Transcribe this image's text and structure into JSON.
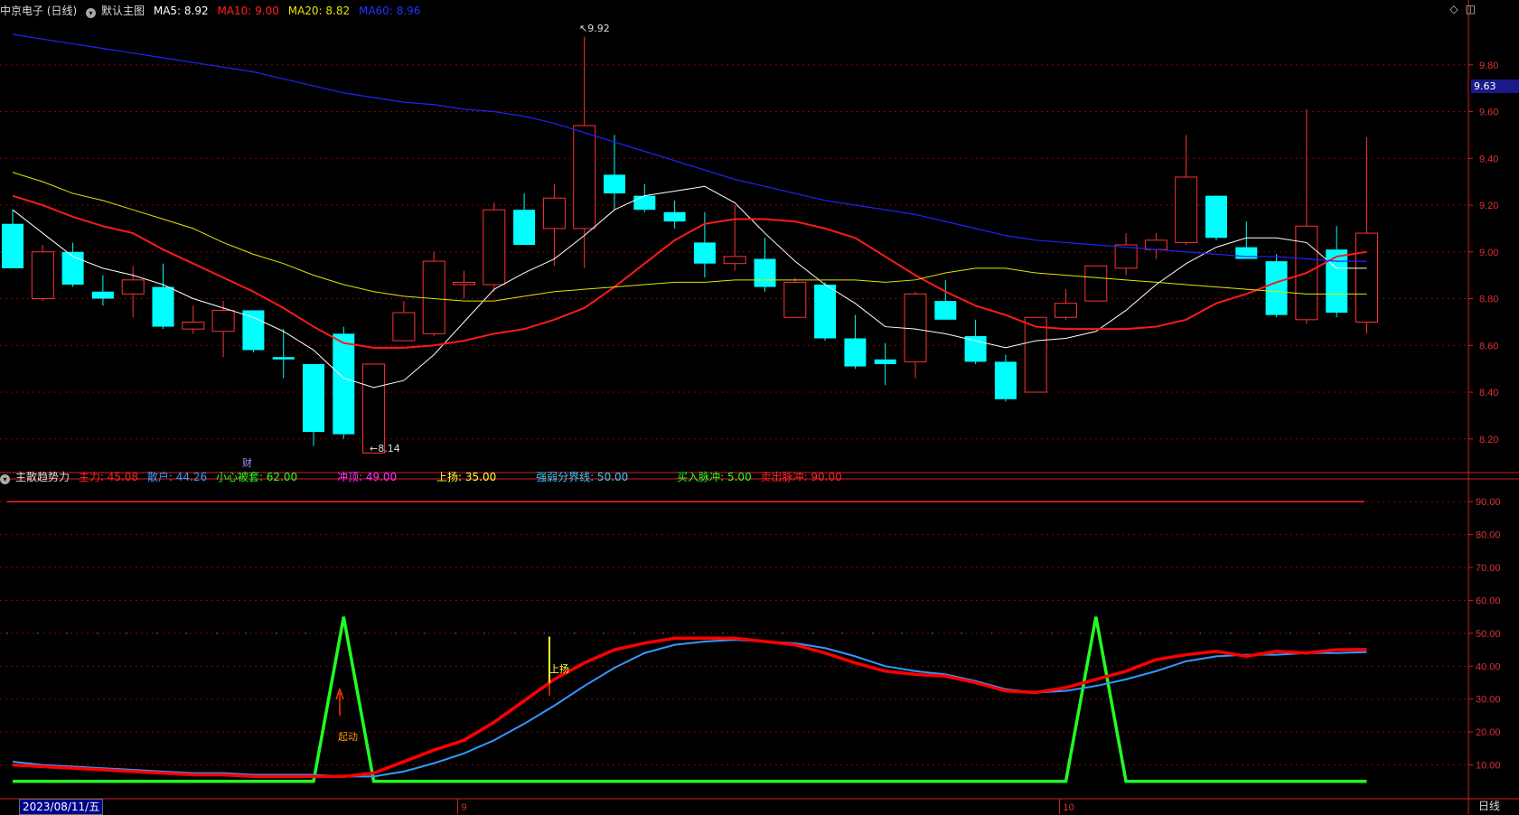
{
  "header_main": {
    "title": "中京电子 (日线)",
    "chart_name": "默认主图",
    "ma5": "MA5: 8.92",
    "ma10": "MA10: 9.00",
    "ma20": "MA20: 8.82",
    "ma60": "MA60: 8.96"
  },
  "header_sub": {
    "name": "主散趋势力",
    "zhuli": "主力: 45.08",
    "sanhu": "散户: 44.26",
    "xiaoxin": "小心被套: 62.00",
    "chongding": "冲顶: 49.00",
    "shangyang": "上扬: 35.00",
    "qiangruo": "强弱分界线: 50.00",
    "mairu": "买入脉冲: 5.00",
    "maichu": "卖出脉冲: 90.00"
  },
  "current_price": "9.63",
  "high_marker": "9.92",
  "low_marker": "8.14",
  "cai_marker": "财",
  "signal_qidong": "起动",
  "signal_shangyang": "上扬",
  "date_cursor": "2023/08/11/五",
  "period_label": "日线",
  "x_labels": [
    {
      "text": "9",
      "index": 15
    },
    {
      "text": "10",
      "index": 35
    }
  ],
  "colors": {
    "up": "#ff3232",
    "down": "#00ffff",
    "ma5": "#ffffff",
    "ma10": "#ff1a1a",
    "ma20": "#e6e600",
    "ma60": "#2222ff",
    "zhuli": "#ff0000",
    "sanhu": "#3399ff",
    "pulse": "#22ff22",
    "grid": "#8b0000",
    "axis": "#cc2222"
  },
  "chart_data": [
    {
      "type": "candlestick",
      "ylim": [
        8.06,
        10.0
      ],
      "yticks": [
        8.2,
        8.4,
        8.6,
        8.8,
        9.0,
        9.2,
        9.4,
        9.6,
        9.8
      ],
      "ohlc": [
        [
          9.12,
          9.18,
          8.93,
          8.93
        ],
        [
          8.8,
          9.03,
          8.79,
          9.0
        ],
        [
          9.0,
          9.04,
          8.85,
          8.86
        ],
        [
          8.83,
          8.9,
          8.77,
          8.8
        ],
        [
          8.82,
          8.94,
          8.72,
          8.88
        ],
        [
          8.85,
          8.95,
          8.67,
          8.68
        ],
        [
          8.67,
          8.77,
          8.65,
          8.7
        ],
        [
          8.66,
          8.79,
          8.55,
          8.75
        ],
        [
          8.75,
          8.75,
          8.57,
          8.58
        ],
        [
          8.55,
          8.67,
          8.46,
          8.54
        ],
        [
          8.52,
          8.52,
          8.17,
          8.23
        ],
        [
          8.65,
          8.68,
          8.2,
          8.22
        ],
        [
          8.14,
          8.52,
          8.14,
          8.52
        ],
        [
          8.62,
          8.79,
          8.62,
          8.74
        ],
        [
          8.65,
          9.0,
          8.64,
          8.96
        ],
        [
          8.86,
          8.92,
          8.8,
          8.87
        ],
        [
          8.86,
          9.21,
          8.83,
          9.18
        ],
        [
          9.18,
          9.25,
          9.03,
          9.03
        ],
        [
          9.1,
          9.29,
          8.94,
          9.23
        ],
        [
          9.1,
          9.92,
          8.93,
          9.54
        ],
        [
          9.33,
          9.5,
          9.18,
          9.25
        ],
        [
          9.24,
          9.29,
          9.17,
          9.18
        ],
        [
          9.17,
          9.22,
          9.1,
          9.13
        ],
        [
          9.04,
          9.17,
          8.89,
          8.95
        ],
        [
          8.95,
          9.2,
          8.92,
          8.98
        ],
        [
          8.97,
          9.06,
          8.83,
          8.85
        ],
        [
          8.72,
          8.89,
          8.72,
          8.87
        ],
        [
          8.86,
          8.87,
          8.62,
          8.63
        ],
        [
          8.63,
          8.73,
          8.5,
          8.51
        ],
        [
          8.54,
          8.61,
          8.43,
          8.52
        ],
        [
          8.53,
          8.83,
          8.46,
          8.82
        ],
        [
          8.79,
          8.88,
          8.73,
          8.71
        ],
        [
          8.64,
          8.71,
          8.52,
          8.53
        ],
        [
          8.53,
          8.56,
          8.36,
          8.37
        ],
        [
          8.4,
          8.72,
          8.4,
          8.72
        ],
        [
          8.72,
          8.84,
          8.71,
          8.78
        ],
        [
          8.79,
          8.94,
          8.79,
          8.94
        ],
        [
          8.93,
          9.08,
          8.9,
          9.03
        ],
        [
          9.01,
          9.08,
          8.97,
          9.05
        ],
        [
          9.04,
          9.5,
          9.03,
          9.32
        ],
        [
          9.24,
          9.24,
          9.05,
          9.06
        ],
        [
          9.02,
          9.13,
          8.98,
          8.97
        ],
        [
          8.96,
          8.99,
          8.72,
          8.73
        ],
        [
          8.71,
          9.61,
          8.69,
          9.11
        ],
        [
          9.01,
          9.11,
          8.72,
          8.74
        ],
        [
          8.7,
          9.49,
          8.65,
          9.08
        ]
      ],
      "series": [
        {
          "name": "MA5",
          "values": [
            9.18,
            9.08,
            8.98,
            8.93,
            8.9,
            8.86,
            8.8,
            8.76,
            8.72,
            8.66,
            8.58,
            8.46,
            8.42,
            8.45,
            8.56,
            8.7,
            8.84,
            8.91,
            8.97,
            9.07,
            9.18,
            9.24,
            9.26,
            9.28,
            9.21,
            9.08,
            8.96,
            8.86,
            8.78,
            8.68,
            8.67,
            8.65,
            8.62,
            8.59,
            8.62,
            8.63,
            8.66,
            8.75,
            8.86,
            8.95,
            9.02,
            9.06,
            9.06,
            9.04,
            8.93,
            8.93
          ]
        },
        {
          "name": "MA10",
          "values": [
            9.24,
            9.2,
            9.15,
            9.11,
            9.08,
            9.01,
            8.95,
            8.89,
            8.83,
            8.76,
            8.68,
            8.61,
            8.59,
            8.59,
            8.6,
            8.62,
            8.65,
            8.67,
            8.71,
            8.76,
            8.85,
            8.95,
            9.05,
            9.12,
            9.14,
            9.14,
            9.13,
            9.1,
            9.06,
            8.98,
            8.9,
            8.83,
            8.77,
            8.73,
            8.68,
            8.67,
            8.67,
            8.67,
            8.68,
            8.71,
            8.78,
            8.82,
            8.87,
            8.91,
            8.98,
            9.0
          ]
        },
        {
          "name": "MA20",
          "values": [
            9.34,
            9.3,
            9.25,
            9.22,
            9.18,
            9.14,
            9.1,
            9.04,
            8.99,
            8.95,
            8.9,
            8.86,
            8.83,
            8.81,
            8.8,
            8.79,
            8.79,
            8.81,
            8.83,
            8.84,
            8.85,
            8.86,
            8.87,
            8.87,
            8.88,
            8.88,
            8.88,
            8.88,
            8.88,
            8.87,
            8.88,
            8.91,
            8.93,
            8.93,
            8.91,
            8.9,
            8.89,
            8.88,
            8.87,
            8.86,
            8.85,
            8.84,
            8.83,
            8.82,
            8.82,
            8.82
          ]
        },
        {
          "name": "MA60",
          "values": [
            9.93,
            9.91,
            9.89,
            9.87,
            9.85,
            9.83,
            9.81,
            9.79,
            9.77,
            9.74,
            9.71,
            9.68,
            9.66,
            9.64,
            9.63,
            9.61,
            9.6,
            9.58,
            9.55,
            9.51,
            9.47,
            9.43,
            9.39,
            9.35,
            9.31,
            9.28,
            9.25,
            9.22,
            9.2,
            9.18,
            9.16,
            9.13,
            9.1,
            9.07,
            9.05,
            9.04,
            9.03,
            9.02,
            9.01,
            9.0,
            8.99,
            8.98,
            8.98,
            8.97,
            8.96,
            8.96
          ]
        }
      ]
    },
    {
      "type": "line",
      "ylim": [
        0,
        95
      ],
      "yticks": [
        10,
        20,
        30,
        40,
        50,
        60,
        70,
        80,
        90
      ],
      "lines": [
        {
          "name": "卖出脉冲",
          "value": 90
        },
        {
          "name": "强弱分界线",
          "value": 50
        }
      ],
      "series": [
        {
          "name": "主力",
          "values": [
            10,
            9.5,
            9,
            8.5,
            8,
            7.5,
            7,
            7,
            6.5,
            6.5,
            6.5,
            6.5,
            7.5,
            11,
            14.5,
            17.5,
            23,
            29.5,
            36,
            41,
            45,
            47,
            48.5,
            48.5,
            48.5,
            47.5,
            46.5,
            44,
            41,
            38.5,
            37.5,
            37,
            35,
            32.5,
            32,
            33.5,
            36,
            38.5,
            42,
            43.5,
            44.5,
            43,
            44.5,
            44,
            45,
            45.08
          ]
        },
        {
          "name": "散户",
          "values": [
            11,
            10,
            9.5,
            9,
            8.5,
            8,
            7.5,
            7.5,
            7,
            7,
            7,
            6.5,
            6.5,
            8,
            10.5,
            13.5,
            17.5,
            22.5,
            28,
            34,
            39.5,
            44,
            46.5,
            47.5,
            48,
            47.5,
            47,
            45.5,
            43,
            40,
            38.5,
            37.5,
            35.5,
            33,
            32,
            32.5,
            34,
            36,
            38.5,
            41.5,
            43,
            43.5,
            43.5,
            44,
            44,
            44.26
          ]
        },
        {
          "name": "脉冲",
          "values": [
            5,
            5,
            5,
            5,
            5,
            5,
            5,
            5,
            5,
            5,
            5,
            55,
            5,
            5,
            5,
            5,
            5,
            5,
            5,
            5,
            5,
            5,
            5,
            5,
            5,
            5,
            5,
            5,
            5,
            5,
            5,
            5,
            5,
            5,
            5,
            5,
            55,
            5,
            5,
            5,
            5,
            5,
            5,
            5,
            5,
            5
          ]
        }
      ]
    }
  ]
}
